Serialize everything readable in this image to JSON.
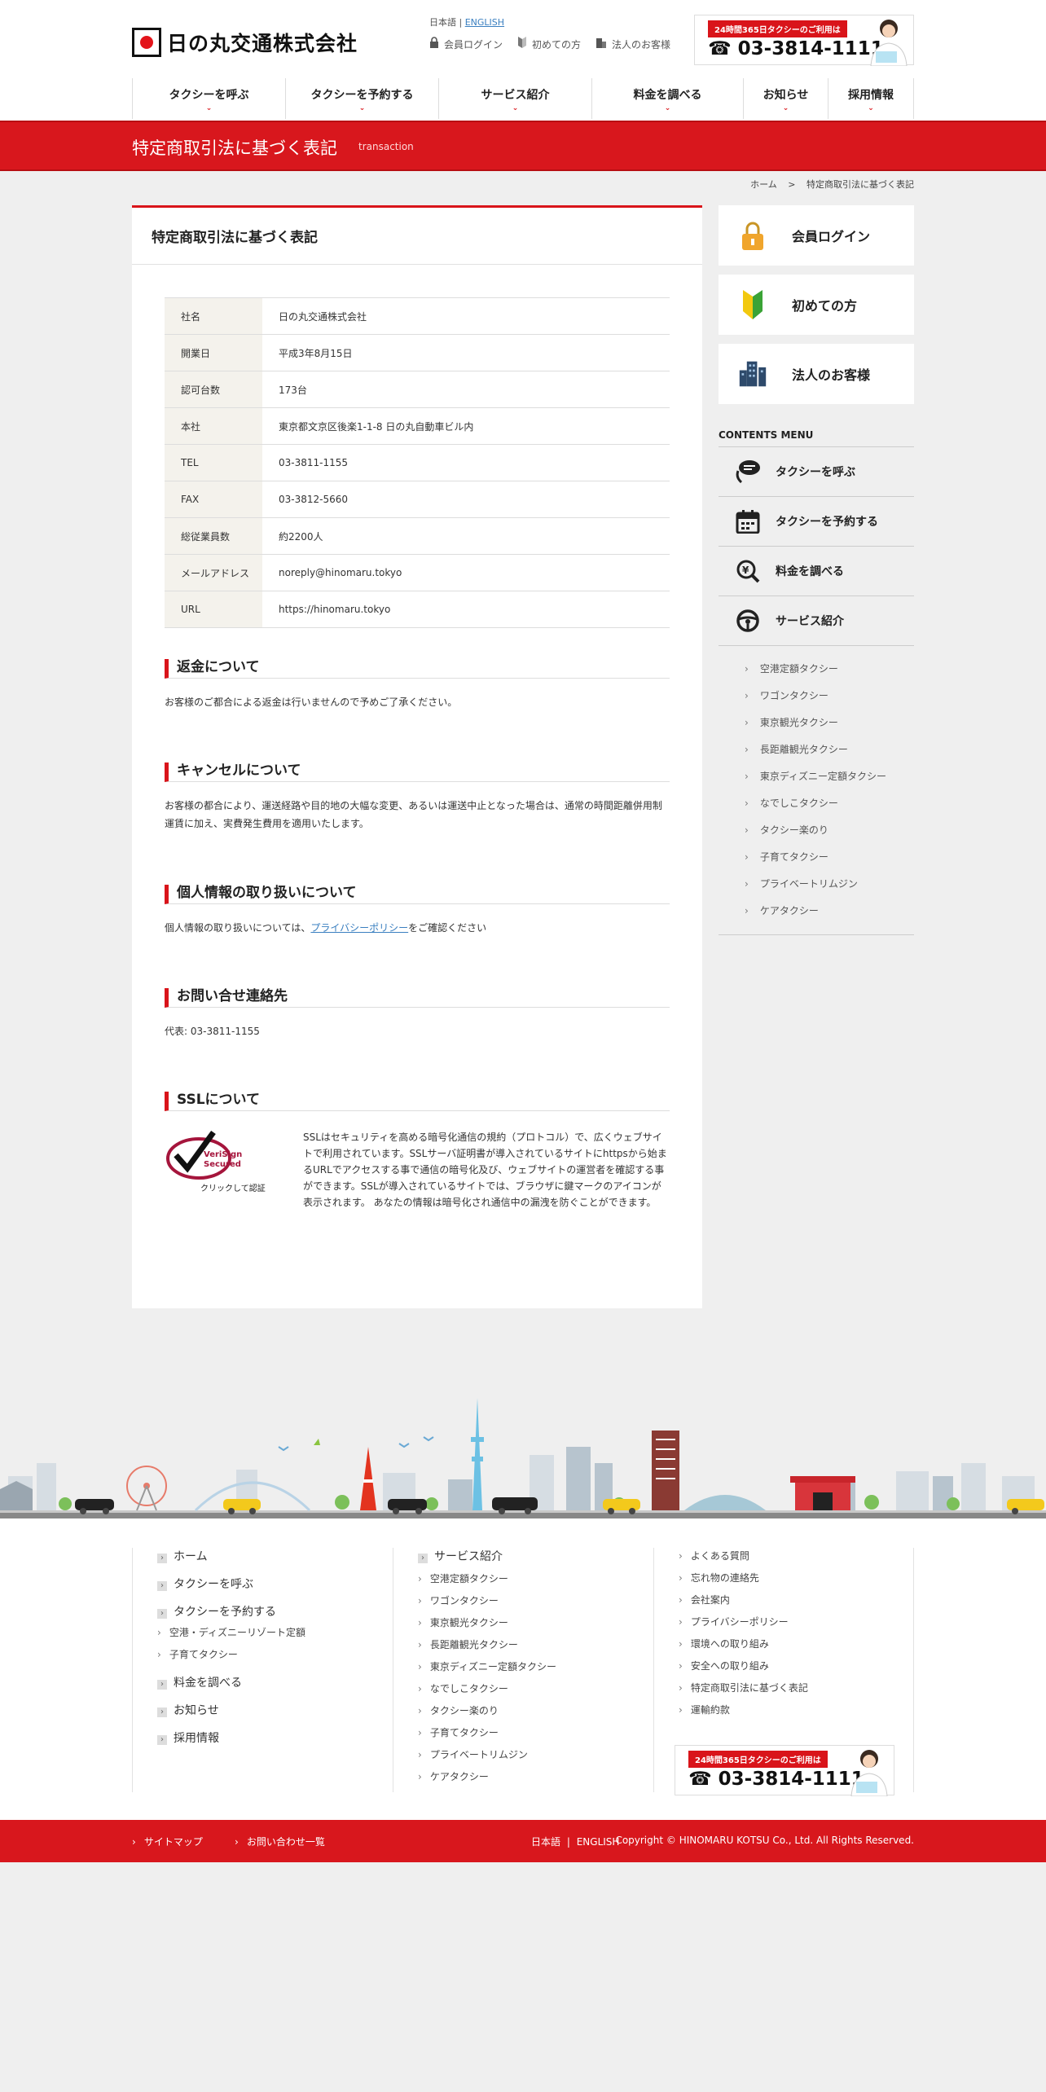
{
  "header": {
    "logo_text": "日の丸交通株式会社",
    "lang_ja": "日本語",
    "lang_sep": "|",
    "lang_en": "ENGLISH",
    "top_links": [
      "会員ログイン",
      "初めての方",
      "法人のお客様"
    ],
    "tel_tag": "24時間365日タクシーのご利用は",
    "tel_number": "☎ 03-3814-1111"
  },
  "nav": [
    "タクシーを呼ぶ",
    "タクシーを予約する",
    "サービス紹介",
    "料金を調べる",
    "お知らせ",
    "採用情報"
  ],
  "page": {
    "title": "特定商取引法に基づく表記",
    "subtitle": "transaction",
    "breadcrumb_home": "ホーム",
    "breadcrumb_sep": ">",
    "breadcrumb_current": "特定商取引法に基づく表記"
  },
  "main": {
    "heading": "特定商取引法に基づく表記",
    "table": [
      {
        "label": "社名",
        "value": "日の丸交通株式会社"
      },
      {
        "label": "開業日",
        "value": "平成3年8月15日"
      },
      {
        "label": "認可台数",
        "value": "173台"
      },
      {
        "label": "本社",
        "value": "東京都文京区後楽1-1-8 日の丸自動車ビル内"
      },
      {
        "label": "TEL",
        "value": "03-3811-1155"
      },
      {
        "label": "FAX",
        "value": "03-3812-5660"
      },
      {
        "label": "総従業員数",
        "value": "約2200人"
      },
      {
        "label": "メールアドレス",
        "value": "noreply@hinomaru.tokyo"
      },
      {
        "label": "URL",
        "value": "https://hinomaru.tokyo"
      }
    ],
    "refund": {
      "title": "返金について",
      "body": "お客様のご都合による返金は行いませんので予めご了承ください。"
    },
    "cancel": {
      "title": "キャンセルについて",
      "body": "お客様の都合により、運送経路や目的地の大幅な変更、あるいは運送中止となった場合は、通常の時間距離併用制運賃に加え、実費発生費用を適用いたします。"
    },
    "privacy": {
      "title": "個人情報の取り扱いについて",
      "body_pre": "個人情報の取り扱いについては、",
      "link": "プライバシーポリシー",
      "body_post": "をご確認ください"
    },
    "contact": {
      "title": "お問い合せ連絡先",
      "body": "代表: 03-3811-1155"
    },
    "ssl": {
      "title": "SSLについて",
      "badge_line1": "VeriSign",
      "badge_line2": "Secured",
      "badge_caption": "クリックして認証",
      "body": "SSLはセキュリティを高める暗号化通信の規約（プロトコル）で、広くウェブサイトで利用されています。SSLサーバ証明書が導入されているサイトにhttpsから始まるURLでアクセスする事で通信の暗号化及び、ウェブサイトの運営者を確認する事ができます。SSLが導入されているサイトでは、ブラウザに鍵マークのアイコンが表示されます。 あなたの情報は暗号化され通信中の漏洩を防ぐことができます。"
    }
  },
  "sidebar": {
    "boxes": [
      "会員ログイン",
      "初めての方",
      "法人のお客様"
    ],
    "contents_menu_title": "CONTENTS MENU",
    "menu": [
      "タクシーを呼ぶ",
      "タクシーを予約する",
      "料金を調べる",
      "サービス紹介"
    ],
    "services": [
      "空港定額タクシー",
      "ワゴンタクシー",
      "東京観光タクシー",
      "長距離観光タクシー",
      "東京ディズニー定額タクシー",
      "なでしこタクシー",
      "タクシー楽のり",
      "子育てタクシー",
      "プライベートリムジン",
      "ケアタクシー"
    ]
  },
  "footer": {
    "col1": {
      "items": [
        "ホーム",
        "タクシーを呼ぶ",
        "タクシーを予約する"
      ],
      "sub": [
        "空港・ディズニーリゾート定額",
        "子育てタクシー"
      ],
      "items2": [
        "料金を調べる",
        "お知らせ",
        "採用情報"
      ]
    },
    "col2": {
      "head": "サービス紹介",
      "items": [
        "空港定額タクシー",
        "ワゴンタクシー",
        "東京観光タクシー",
        "長距離観光タクシー",
        "東京ディズニー定額タクシー",
        "なでしこタクシー",
        "タクシー楽のり",
        "子育てタクシー",
        "プライベートリムジン",
        "ケアタクシー"
      ]
    },
    "col3": {
      "items": [
        "よくある質問",
        "忘れ物の連絡先",
        "会社案内",
        "プライバシーポリシー",
        "環境への取り組み",
        "安全への取り組み",
        "特定商取引法に基づく表記",
        "運輸約款"
      ]
    },
    "tel_tag": "24時間365日タクシーのご利用は",
    "tel_number": "☎ 03-3814-1111"
  },
  "bottom": {
    "sitemap": "サイトマップ",
    "contact_list": "お問い合わせ一覧",
    "lang_ja": "日本語",
    "lang_sep": "|",
    "lang_en": "ENGLISH",
    "copyright": "Copyright © HINOMARU KOTSU Co., Ltd. All Rights Reserved."
  },
  "colors": {
    "brand_red": "#d8171d",
    "link_blue": "#3a7fc0"
  }
}
